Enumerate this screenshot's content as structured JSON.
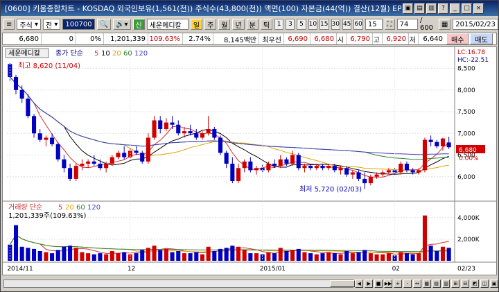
{
  "window": {
    "title": "[0600] 키움종합차트 - KOSDAQ 외국인보유(1,561(천)) 주식수(43,800(천)) 액면(100) 자본금(44(억)) 결산(12월) EPS(",
    "controls": [
      "▣",
      "▤",
      "▥",
      "?",
      "_",
      "□",
      "×"
    ]
  },
  "toolbar": {
    "type_label": "주식",
    "prev_label": "전",
    "code_value": "100700",
    "stock_name": "세운메디칼",
    "name_badge": "신",
    "name_badge2": "일",
    "period_buttons": [
      "분",
      "틱"
    ],
    "unit_buttons": [
      "1",
      "3",
      "5",
      "10",
      "15",
      "30",
      "45",
      "60"
    ],
    "unit_selected": "15",
    "freq_labels": [
      "일",
      "주",
      "월",
      "년"
    ],
    "count_value": "74",
    "count_total": "/ 600",
    "date_value": "2015/02/23"
  },
  "quote": {
    "price": "6,680",
    "change": "0",
    "change_pct": "0%",
    "volume": "1,201,339",
    "vol_ratio": "109.63%",
    "turnover": "2.74%",
    "amount": "8,145백만",
    "best_bid_label": "최우선",
    "best_ask": "6,690",
    "best_bid": "6,680",
    "open_label": "시",
    "open": "6,790",
    "high_label": "고",
    "high": "6,920",
    "low_label": "저",
    "low": "6,640",
    "buy_label": "매수",
    "sell_label": "매도"
  },
  "chart_header": {
    "stock_tag": "세운메디칼",
    "legend_title": "종가 단순",
    "ma_periods": [
      "5",
      "10",
      "20",
      "60",
      "120"
    ],
    "ma_colors": [
      "#d03030",
      "#000000",
      "#e0a000",
      "#308030",
      "#4040c0"
    ],
    "lc_label": "LC:16.78",
    "hc_label": "HC:-22.51",
    "max_label": "최고 8,620 (11/04)",
    "min_label": "최저 5,720 (02/03)",
    "current_price_tag": "6,680",
    "current_pct_tag": "0.00%"
  },
  "volume_header": {
    "title": "거래량 단순",
    "ma_periods": [
      "5",
      "20",
      "60",
      "120"
    ],
    "current": "1,201,339주(109.63%)"
  },
  "chart_data": {
    "type": "candlestick",
    "price_axis": {
      "min": 5500,
      "max": 8700,
      "ticks": [
        6000,
        6500,
        7000,
        7500,
        8000,
        8500
      ],
      "tick_labels": [
        "6,000",
        "6,500",
        "7,000",
        "7,500",
        "8,000",
        "8,500"
      ]
    },
    "volume_axis": {
      "min": 0,
      "max": 4500000,
      "ticks": [
        2000000,
        4000000
      ],
      "tick_labels": [
        "2,000K",
        "4,000K"
      ]
    },
    "x_labels": [
      "2014/11",
      "12",
      "2015/01",
      "02",
      "02/23"
    ],
    "candles": [
      [
        8600,
        8620,
        8200,
        8300
      ],
      [
        8300,
        8350,
        7900,
        8000
      ],
      [
        8000,
        8100,
        7700,
        7800
      ],
      [
        7800,
        7900,
        7350,
        7400
      ],
      [
        7400,
        7450,
        6900,
        7000
      ],
      [
        7000,
        7100,
        6800,
        6850
      ],
      [
        6850,
        6950,
        6700,
        6900
      ],
      [
        6900,
        7000,
        6700,
        6750
      ],
      [
        6750,
        6800,
        6350,
        6400
      ],
      [
        6400,
        6500,
        6100,
        6200
      ],
      [
        6200,
        6300,
        5900,
        5950
      ],
      [
        5950,
        6300,
        5900,
        6250
      ],
      [
        6250,
        6400,
        6150,
        6300
      ],
      [
        6300,
        6400,
        6200,
        6350
      ],
      [
        6350,
        6500,
        6250,
        6300
      ],
      [
        6300,
        6400,
        6150,
        6200
      ],
      [
        6200,
        6350,
        6100,
        6300
      ],
      [
        6300,
        6500,
        6250,
        6450
      ],
      [
        6450,
        6600,
        6400,
        6550
      ],
      [
        6550,
        6700,
        6400,
        6450
      ],
      [
        6450,
        6650,
        6400,
        6600
      ],
      [
        6600,
        6700,
        6500,
        6550
      ],
      [
        6550,
        6600,
        6300,
        6350
      ],
      [
        6350,
        7000,
        6300,
        6900
      ],
      [
        6900,
        7400,
        6850,
        7300
      ],
      [
        7300,
        7400,
        7000,
        7100
      ],
      [
        7100,
        7350,
        7050,
        7250
      ],
      [
        7250,
        7400,
        7100,
        7200
      ],
      [
        7200,
        7300,
        6950,
        7000
      ],
      [
        7000,
        7150,
        6900,
        7050
      ],
      [
        7050,
        7200,
        6950,
        7000
      ],
      [
        7000,
        7100,
        6850,
        6900
      ],
      [
        6900,
        7050,
        6850,
        7000
      ],
      [
        7000,
        7400,
        6950,
        7100
      ],
      [
        7100,
        7150,
        6850,
        6900
      ],
      [
        6900,
        6950,
        6500,
        6550
      ],
      [
        6550,
        6600,
        6200,
        6300
      ],
      [
        6300,
        6450,
        5850,
        5900
      ],
      [
        5900,
        6300,
        5850,
        6200
      ],
      [
        6200,
        6400,
        6100,
        6350
      ],
      [
        6350,
        6450,
        6100,
        6150
      ],
      [
        6150,
        6250,
        6050,
        6200
      ],
      [
        6200,
        6300,
        6100,
        6150
      ],
      [
        6150,
        6350,
        6100,
        6300
      ],
      [
        6300,
        6400,
        6200,
        6250
      ],
      [
        6250,
        6500,
        6200,
        6400
      ],
      [
        6400,
        6450,
        6250,
        6300
      ],
      [
        6300,
        6600,
        6250,
        6500
      ],
      [
        6500,
        6550,
        6150,
        6200
      ],
      [
        6200,
        6300,
        6100,
        6250
      ],
      [
        6250,
        6300,
        6150,
        6200
      ],
      [
        6200,
        6300,
        6150,
        6250
      ],
      [
        6250,
        6300,
        6150,
        6200
      ],
      [
        6200,
        6300,
        6150,
        6250
      ],
      [
        6250,
        6300,
        6100,
        6150
      ],
      [
        6150,
        6250,
        6050,
        6200
      ],
      [
        6200,
        6250,
        6000,
        6050
      ],
      [
        6050,
        6150,
        5950,
        6100
      ],
      [
        6100,
        6150,
        5900,
        5950
      ],
      [
        5950,
        6100,
        5720,
        5850
      ],
      [
        5850,
        6050,
        5800,
        6000
      ],
      [
        6000,
        6100,
        5950,
        6050
      ],
      [
        6050,
        6150,
        6000,
        6100
      ],
      [
        6100,
        6200,
        6050,
        6150
      ],
      [
        6150,
        6200,
        6050,
        6100
      ],
      [
        6100,
        6350,
        6050,
        6300
      ],
      [
        6300,
        6350,
        6100,
        6150
      ],
      [
        6150,
        6200,
        6050,
        6100
      ],
      [
        6100,
        6200,
        6050,
        6150
      ],
      [
        6150,
        6900,
        6100,
        6850
      ],
      [
        6850,
        6950,
        6700,
        6800
      ],
      [
        6800,
        6850,
        6650,
        6700
      ],
      [
        6700,
        6900,
        6600,
        6880
      ],
      [
        6790,
        6920,
        6640,
        6680
      ]
    ],
    "volumes": [
      1500000,
      3300000,
      1300000,
      1200000,
      1100000,
      900000,
      800000,
      700000,
      1000000,
      1300000,
      1400000,
      1200000,
      800000,
      700000,
      600000,
      700000,
      600000,
      900000,
      700000,
      800000,
      600000,
      700000,
      1000000,
      1200000,
      1400000,
      1000000,
      1100000,
      800000,
      900000,
      700000,
      700000,
      800000,
      600000,
      1300000,
      900000,
      1100000,
      1200000,
      1400000,
      1300000,
      1000000,
      700000,
      700000,
      600000,
      800000,
      700000,
      1200000,
      900000,
      1000000,
      1100000,
      800000,
      700000,
      600000,
      700000,
      800000,
      700000,
      600000,
      900000,
      700000,
      800000,
      1000000,
      700000,
      600000,
      600000,
      700000,
      500000,
      800000,
      700000,
      600000,
      700000,
      4200000,
      1400000,
      900000,
      1300000,
      1201339
    ]
  },
  "nav": {
    "buttons": [
      "◀",
      "▶",
      "■",
      "▶▶",
      "+",
      "-",
      "↔",
      "▦",
      "▤",
      "▥",
      "⊞",
      "⊟",
      "◩",
      "◫",
      "▣"
    ]
  }
}
